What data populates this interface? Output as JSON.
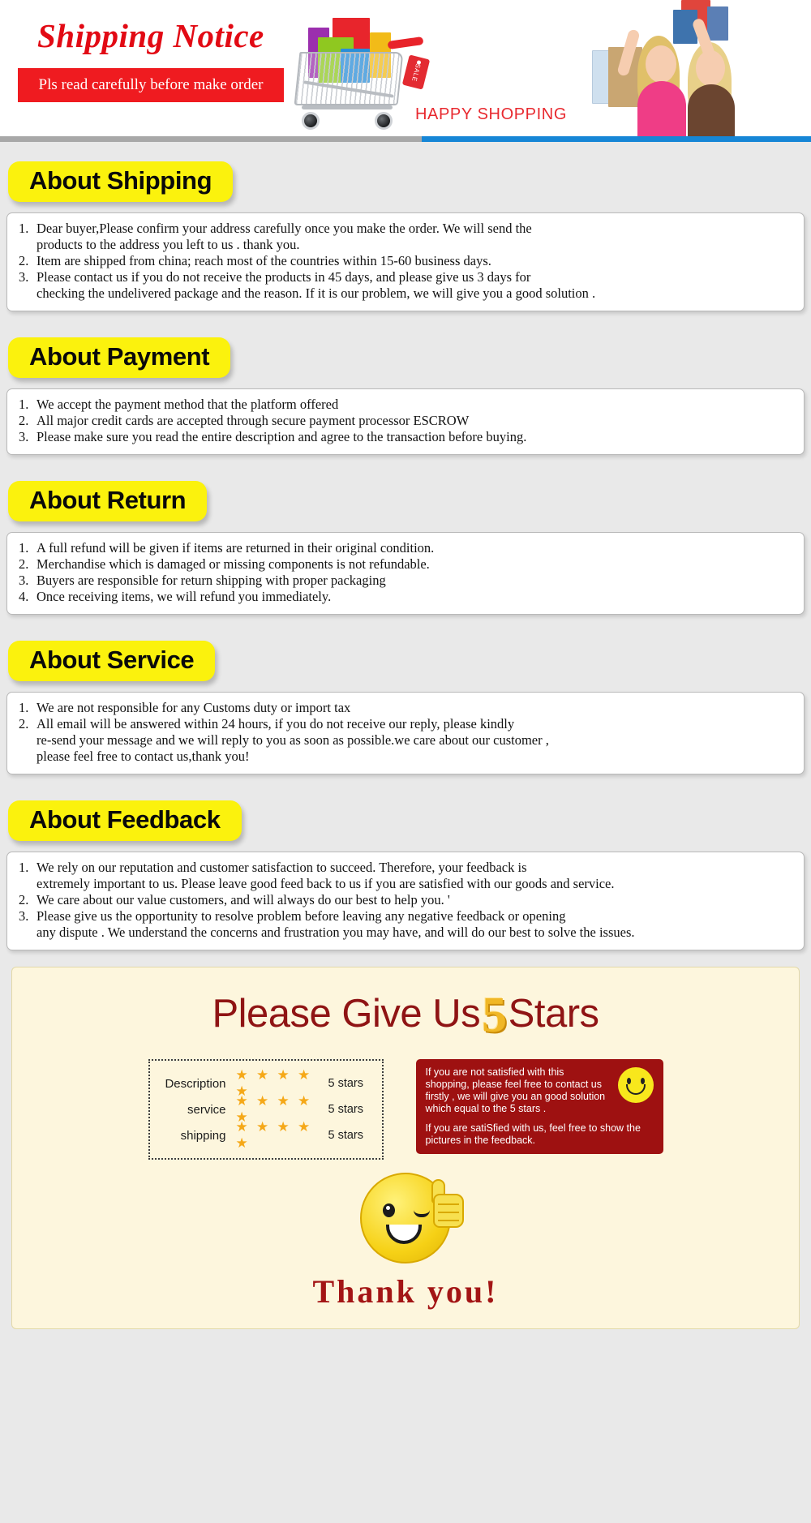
{
  "header": {
    "title": "Shipping Notice",
    "banner_text": "Pls read carefully before make order",
    "happy_shopping": "HAPPY SHOPPING",
    "sale_tag": "SALE",
    "accent_red": "#e20a14",
    "banner_red": "#ef1b20",
    "blue_bar": "#1686d6"
  },
  "sections": [
    {
      "heading": "About Shipping",
      "items": [
        {
          "num": "1.",
          "line1": "Dear buyer,Please confirm your address carefully once you make the order. We will send the",
          "line2": "products to the address you left to us . thank you."
        },
        {
          "num": "2.",
          "line1": "Item are shipped from china; reach most of the countries within 15-60 business days.",
          "line2": ""
        },
        {
          "num": "3.",
          "line1": "Please contact us if you do not receive the products in 45 days, and please give us 3 days for",
          "line2": "checking the undelivered package and the reason. If it is our problem, we will give you a good solution ."
        }
      ]
    },
    {
      "heading": "About Payment",
      "items": [
        {
          "num": "1.",
          "line1": "We accept the payment method that the platform offered",
          "line2": ""
        },
        {
          "num": "2.",
          "line1": "All major credit cards are accepted through secure payment processor ESCROW",
          "line2": ""
        },
        {
          "num": "3.",
          "line1": "Please make sure you read the entire description and agree to the transaction before buying.",
          "line2": ""
        }
      ]
    },
    {
      "heading": "About Return",
      "items": [
        {
          "num": "1.",
          "line1": "A full refund will be given if items are returned in their original condition.",
          "line2": ""
        },
        {
          "num": "2.",
          "line1": "Merchandise which is damaged or missing components is not refundable.",
          "line2": ""
        },
        {
          "num": "3.",
          "line1": "Buyers are responsible for return shipping with proper packaging",
          "line2": ""
        },
        {
          "num": "4.",
          "line1": "Once receiving items, we will refund you immediately.",
          "line2": ""
        }
      ]
    },
    {
      "heading": "About Service",
      "items": [
        {
          "num": "1.",
          "line1": "We are not responsible for any Customs duty or import tax",
          "line2": ""
        },
        {
          "num": "2.",
          "line1": "All email will be answered within 24 hours, if you do not receive our reply, please kindly",
          "line2": "re-send your message and we will reply to you as soon as possible.we care about our customer ,",
          "line3": "please feel free to contact us,thank you!"
        }
      ]
    },
    {
      "heading": "About Feedback",
      "items": [
        {
          "num": "1.",
          "line1": "We rely on our reputation and customer satisfaction to succeed. Therefore, your feedback is",
          "line2": "extremely important to us. Please leave good feed back to us if you are satisfied with our goods and service."
        },
        {
          "num": "2.",
          "line1": "We care about our value customers, and will always do our best to help you. '",
          "line2": ""
        },
        {
          "num": "3.",
          "line1": "Please give us the opportunity to resolve problem before leaving any negative feedback or opening",
          "line2": "any dispute . We understand the concerns and frustration you may have, and will do our best to solve the issues."
        }
      ]
    }
  ],
  "footer": {
    "title_pre": "Please Give Us",
    "title_digit": "5",
    "title_post": "Stars",
    "ratings": [
      {
        "label": "Description",
        "stars": "★ ★ ★ ★ ★",
        "value": "5 stars"
      },
      {
        "label": "service",
        "stars": "★ ★ ★ ★ ★",
        "value": "5 stars"
      },
      {
        "label": "shipping",
        "stars": "★ ★ ★ ★ ★",
        "value": "5 stars"
      }
    ],
    "tip_line1": "If you are not satisfied with this shopping, please feel free to contact us firstly , we will give you an good solution which equal to the 5 stars .",
    "tip_line2": "If you are satiSfied with us, feel free to show the pictures in the feedback.",
    "thank_you": "Thank you!",
    "bg_color": "#fdf6dd",
    "title_color": "#8f1414",
    "digit_color": "#f0b726",
    "tip_bg": "#9e1111",
    "star_color": "#f5a818"
  }
}
